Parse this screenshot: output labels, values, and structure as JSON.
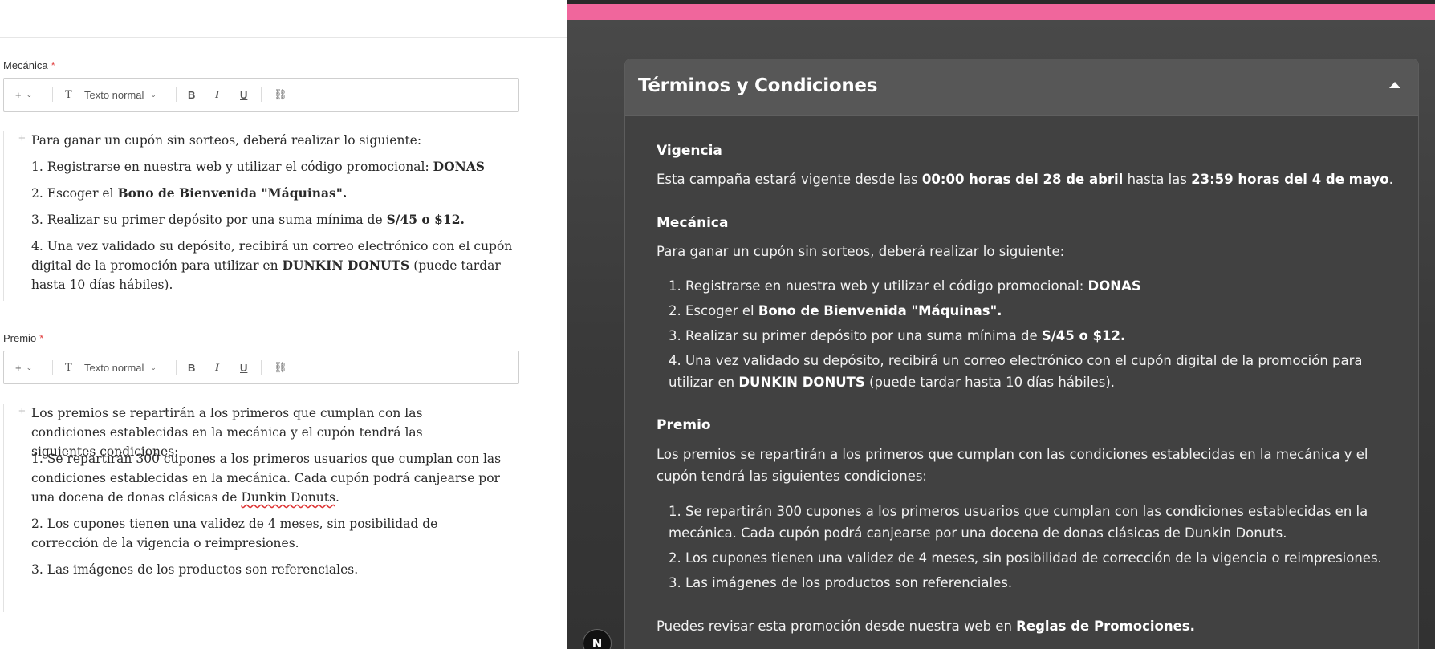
{
  "editor": {
    "toolbar": {
      "add_icon": "plus-icon",
      "text_style_icon": "T",
      "text_style": "Texto normal",
      "bold": "B",
      "italic": "I",
      "underline": "U",
      "link_icon": "link-icon"
    },
    "mecanica": {
      "label": "Mecánica",
      "required_mark": "*",
      "intro": "Para ganar un cupón sin sorteos, deberá realizar lo siguiente:",
      "item1_text": "1. Registrarse en nuestra web y utilizar el código promocional: ",
      "item1_bold": "DONAS",
      "item2_text": "2. Escoger el ",
      "item2_bold": "Bono de Bienvenida \"Máquinas\".",
      "item3_text": "3. Realizar su primer depósito por una suma mínima de ",
      "item3_bold": "S/45 o $12.",
      "item4_text": "4. Una vez validado su depósito, recibirá un correo electrónico con el cupón digital de la promoción para utilizar en ",
      "item4_bold": "DUNKIN DONUTS",
      "item4_tail": " (puede tardar hasta 10 días hábiles)."
    },
    "premio": {
      "label": "Premio",
      "required_mark": "*",
      "intro": "Los premios se repartirán a los primeros que cumplan con las condiciones establecidas en la mecánica y el cupón tendrá las siguientes condiciones:",
      "item1": "1. Se repartirán 300 cupones a los primeros usuarios que cumplan con las condiciones establecidas en la mecánica. Cada cupón podrá canjearse por una docena de donas clásicas de ",
      "item1_spell": "Dunkin Donuts",
      "item1_end": ".",
      "item2": "2. Los cupones tienen una validez de 4 meses, sin posibilidad de corrección de la vigencia o reimpresiones.",
      "item3": "3. Las imágenes de los productos son referenciales."
    }
  },
  "preview": {
    "accent": "#f0669c",
    "card_title": "Términos y Condiciones",
    "vigencia": {
      "heading": "Vigencia",
      "text1": "Esta campaña estará vigente desde las ",
      "bold1": "00:00 horas del 28 de abril",
      "text2": " hasta las ",
      "bold2": "23:59 horas del 4 de mayo",
      "text3": "."
    },
    "mecanica": {
      "heading": "Mecánica",
      "intro": "Para ganar un cupón sin sorteos, deberá realizar lo siguiente:",
      "item1_text": "1. Registrarse en nuestra web y utilizar el código promocional: ",
      "item1_bold": "DONAS",
      "item2_text": "2. Escoger el ",
      "item2_bold": "Bono de Bienvenida \"Máquinas\".",
      "item3_text": "3. Realizar su primer depósito por una suma mínima de ",
      "item3_bold": "S/45 o $12.",
      "item4_text": "4. Una vez validado su depósito, recibirá un correo electrónico con el cupón digital de la promoción para utilizar en ",
      "item4_bold": "DUNKIN DONUTS",
      "item4_tail": " (puede tardar hasta 10 días hábiles)."
    },
    "premio": {
      "heading": "Premio",
      "intro": "Los premios se repartirán a los primeros que cumplan con las condiciones establecidas en la mecánica y el cupón tendrá las siguientes condiciones:",
      "item1": "1. Se repartirán 300 cupones a los primeros usuarios que cumplan con las condiciones establecidas en la mecánica. Cada cupón podrá canjearse por una docena de donas clásicas de Dunkin Donuts.",
      "item2": "2. Los cupones tienen una validez de 4 meses, sin posibilidad de corrección de la vigencia o reimpresiones.",
      "item3": "3. Las imágenes de los productos son referenciales."
    },
    "footer_text": "Puedes revisar esta promoción desde nuestra web en ",
    "footer_link": "Reglas de Promociones.",
    "badge": "N"
  }
}
